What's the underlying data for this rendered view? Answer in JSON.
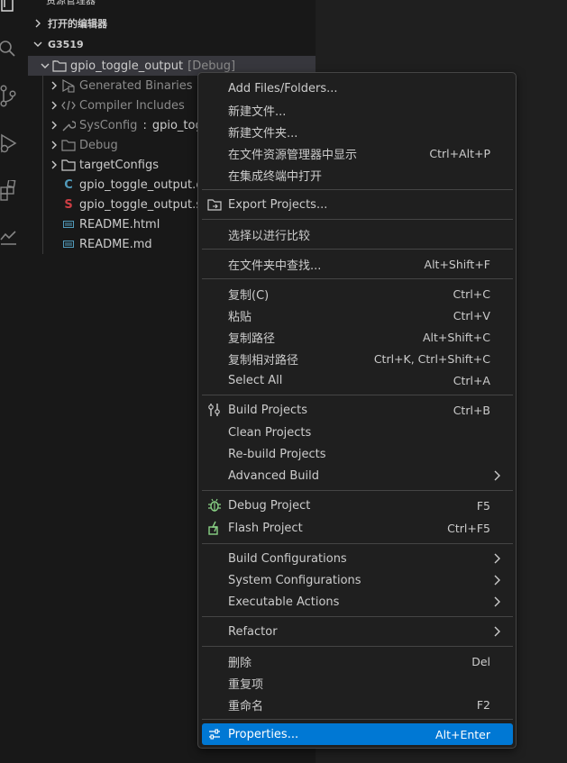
{
  "sidebar": {
    "title": "资源管理器",
    "open_editors": "打开的编辑器",
    "workspace": "G3519",
    "project": {
      "name": "gpio_toggle_output",
      "tag": "[Debug]"
    },
    "items": [
      {
        "label": "Generated Binaries",
        "icon": "generated-binaries-icon"
      },
      {
        "label": "Compiler Includes",
        "icon": "code-icon"
      },
      {
        "label": "SysConfig",
        "sep": ":",
        "extra": "gpio_togg",
        "icon": "wrench-icon"
      },
      {
        "label": "Debug",
        "icon": "folder-icon"
      },
      {
        "label": "targetConfigs",
        "icon": "folder-icon"
      },
      {
        "label": "gpio_toggle_output.c",
        "icon": "c-file-icon"
      },
      {
        "label": "gpio_toggle_output.sy",
        "icon": "syscfg-file-icon"
      },
      {
        "label": "README.html",
        "icon": "html-file-icon"
      },
      {
        "label": "README.md",
        "icon": "markdown-file-icon"
      }
    ]
  },
  "context_menu": {
    "items": [
      {
        "label": "Add Files/Folders...",
        "key": ""
      },
      {
        "label": "新建文件...",
        "key": ""
      },
      {
        "label": "新建文件夹...",
        "key": ""
      },
      {
        "label": "在文件资源管理器中显示",
        "key": "Ctrl+Alt+P"
      },
      {
        "label": "在集成终端中打开",
        "key": ""
      },
      {
        "label": "Export Projects...",
        "key": "",
        "icon": "export-icon"
      },
      {
        "label": "选择以进行比较",
        "key": ""
      },
      {
        "label": "在文件夹中查找...",
        "key": "Alt+Shift+F"
      },
      {
        "label": "复制(C)",
        "key": "Ctrl+C"
      },
      {
        "label": "粘贴",
        "key": "Ctrl+V"
      },
      {
        "label": "复制路径",
        "key": "Alt+Shift+C"
      },
      {
        "label": "复制相对路径",
        "key": "Ctrl+K, Ctrl+Shift+C"
      },
      {
        "label": "Select All",
        "key": "Ctrl+A"
      },
      {
        "label": "Build Projects",
        "key": "Ctrl+B",
        "icon": "build-icon"
      },
      {
        "label": "Clean Projects",
        "key": ""
      },
      {
        "label": "Re-build Projects",
        "key": ""
      },
      {
        "label": "Advanced Build",
        "key": "",
        "submenu": true
      },
      {
        "label": "Debug Project",
        "key": "F5",
        "icon": "debug-icon"
      },
      {
        "label": "Flash Project",
        "key": "Ctrl+F5",
        "icon": "flash-icon"
      },
      {
        "label": "Build Configurations",
        "key": "",
        "submenu": true
      },
      {
        "label": "System Configurations",
        "key": "",
        "submenu": true
      },
      {
        "label": "Executable Actions",
        "key": "",
        "submenu": true
      },
      {
        "label": "Refactor",
        "key": "",
        "submenu": true
      },
      {
        "label": "删除",
        "key": "Del"
      },
      {
        "label": "重复项",
        "key": ""
      },
      {
        "label": "重命名",
        "key": "F2"
      },
      {
        "label": "Properties...",
        "key": "Alt+Enter",
        "icon": "settings-sliders-icon",
        "active": true
      }
    ]
  },
  "colors": {
    "menu_bg": "#1f1f1f",
    "highlight": "#0078d4",
    "sidebar_bg": "#181818",
    "accent_green": "#89d185",
    "c_file_blue": "#519aba",
    "syscfg_red": "#cc3e44"
  }
}
